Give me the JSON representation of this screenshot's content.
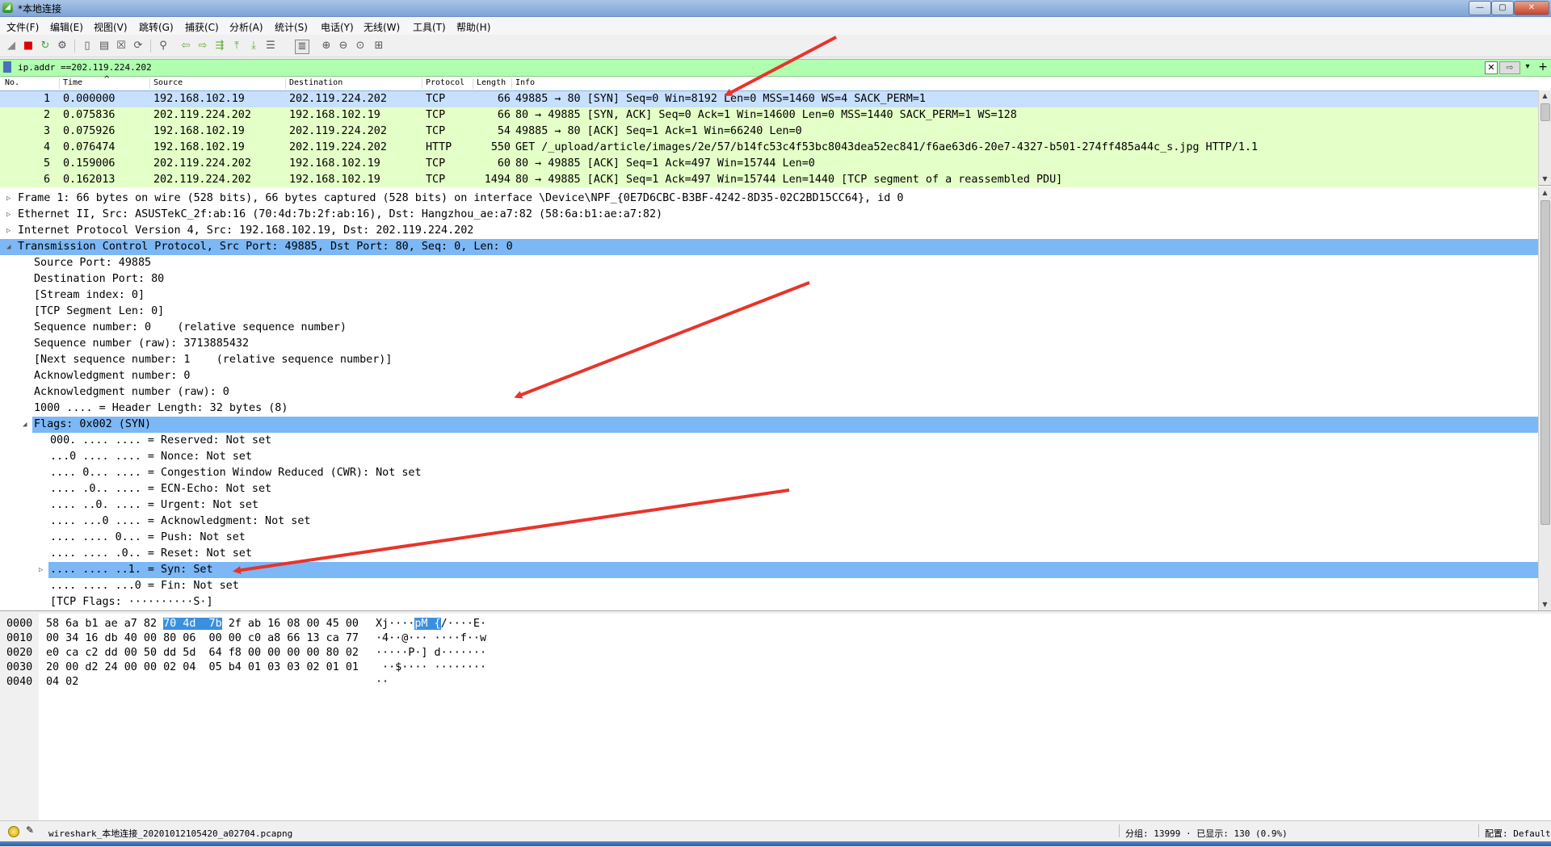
{
  "window": {
    "title": "*本地连接",
    "min_label": "—",
    "max_label": "▢",
    "close_label": "✕"
  },
  "menu": [
    "文件(F)",
    "编辑(E)",
    "视图(V)",
    "跳转(G)",
    "捕获(C)",
    "分析(A)",
    "统计(S)",
    "电话(Y)",
    "无线(W)",
    "工具(T)",
    "帮助(H)"
  ],
  "filter": {
    "value": "ip.addr ==202.119.224.202",
    "clear": "✕",
    "apply": "⇨",
    "dropdown": "▾",
    "add": "+"
  },
  "packet_list": {
    "columns": [
      "No.",
      "Time",
      "Source",
      "Destination",
      "Protocol",
      "Length",
      "Info"
    ],
    "rows": [
      {
        "no": "1",
        "time": "0.000000",
        "src": "192.168.102.19",
        "dst": "202.119.224.202",
        "proto": "TCP",
        "len": "66",
        "info": "49885 → 80 [SYN] Seq=0 Win=8192 Len=0 MSS=1460 WS=4 SACK_PERM=1"
      },
      {
        "no": "2",
        "time": "0.075836",
        "src": "202.119.224.202",
        "dst": "192.168.102.19",
        "proto": "TCP",
        "len": "66",
        "info": "80 → 49885 [SYN, ACK] Seq=0 Ack=1 Win=14600 Len=0 MSS=1440 SACK_PERM=1 WS=128"
      },
      {
        "no": "3",
        "time": "0.075926",
        "src": "192.168.102.19",
        "dst": "202.119.224.202",
        "proto": "TCP",
        "len": "54",
        "info": "49885 → 80 [ACK] Seq=1 Ack=1 Win=66240 Len=0"
      },
      {
        "no": "4",
        "time": "0.076474",
        "src": "192.168.102.19",
        "dst": "202.119.224.202",
        "proto": "HTTP",
        "len": "550",
        "info": "GET /_upload/article/images/2e/57/b14fc53c4f53bc8043dea52ec841/f6ae63d6-20e7-4327-b501-274ff485a44c_s.jpg HTTP/1.1"
      },
      {
        "no": "5",
        "time": "0.159006",
        "src": "202.119.224.202",
        "dst": "192.168.102.19",
        "proto": "TCP",
        "len": "60",
        "info": "80 → 49885 [ACK] Seq=1 Ack=497 Win=15744 Len=0"
      },
      {
        "no": "6",
        "time": "0.162013",
        "src": "202.119.224.202",
        "dst": "192.168.102.19",
        "proto": "TCP",
        "len": "1494",
        "info": "80 → 49885 [ACK] Seq=1 Ack=497 Win=15744 Len=1440 [TCP segment of a reassembled PDU]"
      }
    ]
  },
  "details": [
    {
      "exp": "▷",
      "indent": 0,
      "text": "Frame 1: 66 bytes on wire (528 bits), 66 bytes captured (528 bits) on interface \\Device\\NPF_{0E7D6CBC-B3BF-4242-8D35-02C2BD15CC64}, id 0"
    },
    {
      "exp": "▷",
      "indent": 0,
      "text": "Ethernet II, Src: ASUSTekC_2f:ab:16 (70:4d:7b:2f:ab:16), Dst: Hangzhou_ae:a7:82 (58:6a:b1:ae:a7:82)"
    },
    {
      "exp": "▷",
      "indent": 0,
      "text": "Internet Protocol Version 4, Src: 192.168.102.19, Dst: 202.119.224.202"
    },
    {
      "exp": "◢",
      "indent": 0,
      "text": "Transmission Control Protocol, Src Port: 49885, Dst Port: 80, Seq: 0, Len: 0",
      "hl": true
    },
    {
      "exp": "",
      "indent": 1,
      "text": "Source Port: 49885"
    },
    {
      "exp": "",
      "indent": 1,
      "text": "Destination Port: 80"
    },
    {
      "exp": "",
      "indent": 1,
      "text": "[Stream index: 0]"
    },
    {
      "exp": "",
      "indent": 1,
      "text": "[TCP Segment Len: 0]"
    },
    {
      "exp": "",
      "indent": 1,
      "text": "Sequence number: 0    (relative sequence number)"
    },
    {
      "exp": "",
      "indent": 1,
      "text": "Sequence number (raw): 3713885432"
    },
    {
      "exp": "",
      "indent": 1,
      "text": "[Next sequence number: 1    (relative sequence number)]"
    },
    {
      "exp": "",
      "indent": 1,
      "text": "Acknowledgment number: 0"
    },
    {
      "exp": "",
      "indent": 1,
      "text": "Acknowledgment number (raw): 0"
    },
    {
      "exp": "",
      "indent": 1,
      "text": "1000 .... = Header Length: 32 bytes (8)"
    },
    {
      "exp": "◢",
      "indent": 1,
      "text": "Flags: 0x002 (SYN)",
      "hl": true
    },
    {
      "exp": "",
      "indent": 2,
      "text": "000. .... .... = Reserved: Not set"
    },
    {
      "exp": "",
      "indent": 2,
      "text": "...0 .... .... = Nonce: Not set"
    },
    {
      "exp": "",
      "indent": 2,
      "text": ".... 0... .... = Congestion Window Reduced (CWR): Not set"
    },
    {
      "exp": "",
      "indent": 2,
      "text": ".... .0.. .... = ECN-Echo: Not set"
    },
    {
      "exp": "",
      "indent": 2,
      "text": ".... ..0. .... = Urgent: Not set"
    },
    {
      "exp": "",
      "indent": 2,
      "text": ".... ...0 .... = Acknowledgment: Not set"
    },
    {
      "exp": "",
      "indent": 2,
      "text": ".... .... 0... = Push: Not set"
    },
    {
      "exp": "",
      "indent": 2,
      "text": ".... .... .0.. = Reset: Not set"
    },
    {
      "exp": "▷",
      "indent": 2,
      "text": ".... .... ..1. = Syn: Set",
      "hl": true
    },
    {
      "exp": "",
      "indent": 2,
      "text": ".... .... ...0 = Fin: Not set"
    },
    {
      "exp": "",
      "indent": 2,
      "text": "[TCP Flags: ··········S·]"
    }
  ],
  "bytes": [
    {
      "offset": "0000",
      "hex_a": "58 6a b1 ae a7 82 ",
      "hex_hl": "70 4d  7b",
      "hex_b": " 2f ab 16 08 00 45 00",
      "asc_a": "Xj····",
      "asc_hl": "pM {",
      "asc_b": "/····E·"
    },
    {
      "offset": "0010",
      "hex_a": "00 34 16 db 40 00 80 06  00 00 c0 a8 66 13 ca 77",
      "hex_hl": "",
      "hex_b": "",
      "asc_a": "·4··@··· ····f··w",
      "asc_hl": "",
      "asc_b": ""
    },
    {
      "offset": "0020",
      "hex_a": "e0 ca c2 dd 00 50 dd 5d  64 f8 00 00 00 00 80 02",
      "hex_hl": "",
      "hex_b": "",
      "asc_a": "·····P·] d·······",
      "asc_hl": "",
      "asc_b": ""
    },
    {
      "offset": "0030",
      "hex_a": "20 00 d2 24 00 00 02 04  05 b4 01 03 03 02 01 01",
      "hex_hl": "",
      "hex_b": "",
      "asc_a": " ··$···· ········",
      "asc_hl": "",
      "asc_b": ""
    },
    {
      "offset": "0040",
      "hex_a": "04 02",
      "hex_hl": "",
      "hex_b": "",
      "asc_a": "··",
      "asc_hl": "",
      "asc_b": ""
    }
  ],
  "status": {
    "file": "wireshark_本地连接_20201012105420_a02704.pcapng",
    "packets": "分组: 13999 · 已显示: 130 (0.9%)",
    "profile": "配置: Default"
  },
  "colors": {
    "row_bg": "#e4ffc7",
    "selected_row": "#c7e0ff",
    "highlight": "#7cb7f6",
    "filter_bg": "#afffaf",
    "arrow": "#e8342c"
  },
  "annotations": {
    "arrow_count": 3
  }
}
